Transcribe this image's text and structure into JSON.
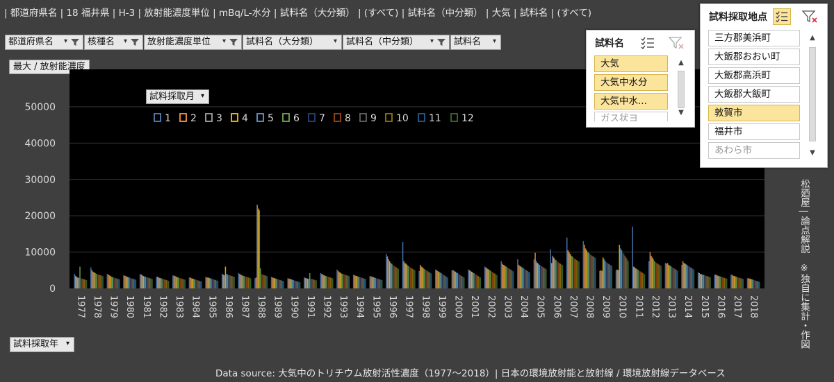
{
  "topbar": {
    "text": "| 都道府県名 | 18 福井県 | H-3 | 放射能濃度単位 | mBq/L-水分 | 試料名（大分類） | (すべて) | 試料名（中分類） | 大気 | 試料名 | (すべて)"
  },
  "fields": {
    "prefecture": "都道府県名",
    "nuclide": "核種名",
    "unit": "放射能濃度単位",
    "sample_major": "試料名（大分類）",
    "sample_mid": "試料名（中分類）",
    "sample": "試料名",
    "values_label": "最大 / 放射能濃度",
    "axis_field": "試料採取年",
    "legend_field": "試料採取月"
  },
  "slicer_sample": {
    "title": "試料名",
    "items": [
      "大気",
      "大気中水分",
      "大気中水...",
      "ガス状ヨ"
    ]
  },
  "slicer_location": {
    "title": "試料採取地点",
    "items": [
      "三方郡美浜町",
      "大飯郡おおい町",
      "大飯郡高浜町",
      "大飯郡大飯町",
      "敦賀市",
      "福井市",
      "あわら市"
    ]
  },
  "side_note": "松廼屋 | 論点解説　※独自に集計・作図",
  "footer": "Data source: 大気中のトリチウム放射活性濃度（1977～2018）| 日本の環境放射能と放射線 / 環境放射線データベース",
  "colors": {
    "m1": "#4f81bd",
    "m2": "#f79646",
    "m3": "#a5a5a5",
    "m4": "#ffc000",
    "m5": "#5b9bd5",
    "m6": "#70ad47",
    "m7": "#264478",
    "m8": "#9e480e",
    "m9": "#636363",
    "m10": "#997300",
    "m11": "#255e91",
    "m12": "#43682b"
  },
  "chart_data": {
    "type": "bar",
    "title": "",
    "xlabel": "試料採取年",
    "ylabel": "最大 / 放射能濃度",
    "ylim": [
      0,
      50000
    ],
    "yticks": [
      0,
      10000,
      20000,
      30000,
      40000,
      50000
    ],
    "grid": true,
    "legend_placement": "top-left",
    "categories": [
      "1977",
      "1978",
      "1979",
      "1980",
      "1981",
      "1982",
      "1983",
      "1984",
      "1985",
      "1986",
      "1987",
      "1988",
      "1989",
      "1990",
      "1991",
      "1992",
      "1993",
      "1994",
      "1995",
      "1996",
      "1997",
      "1998",
      "1999",
      "2000",
      "2001",
      "2002",
      "2003",
      "2004",
      "2005",
      "2006",
      "2007",
      "2008",
      "2009",
      "2010",
      "2011",
      "2012",
      "2013",
      "2014",
      "2015",
      "2016",
      "2017",
      "2018"
    ],
    "series": [
      {
        "name": "1",
        "values": [
          4000,
          5800,
          4000,
          3600,
          4000,
          3200,
          3600,
          3000,
          3200,
          4000,
          4200,
          2800,
          3200,
          2800,
          3000,
          4200,
          5200,
          3800,
          3400,
          9500,
          12800,
          4800,
          5200,
          5000,
          5200,
          6000,
          7500,
          8000,
          8000,
          10800,
          14000,
          13000,
          4800,
          5000,
          17000,
          7500,
          7000,
          6500,
          4500,
          3800,
          3800,
          2800
        ]
      },
      {
        "name": "2",
        "values": [
          3500,
          5000,
          3800,
          3500,
          3800,
          3200,
          3500,
          3000,
          3000,
          3800,
          4000,
          3000,
          3000,
          2700,
          2900,
          4000,
          4800,
          3600,
          3300,
          8800,
          7500,
          6500,
          5000,
          5000,
          5000,
          5800,
          6800,
          6500,
          9800,
          7000,
          10500,
          12000,
          5000,
          5200,
          6000,
          10000,
          6800,
          7500,
          4200,
          3800,
          3700,
          2800
        ]
      },
      {
        "name": "3",
        "values": [
          3200,
          4600,
          3600,
          3400,
          3600,
          3000,
          3400,
          2800,
          3000,
          3600,
          3800,
          23000,
          2900,
          2600,
          2800,
          3800,
          4500,
          3500,
          3200,
          8000,
          7000,
          6000,
          4800,
          4800,
          4800,
          5500,
          6500,
          6200,
          7500,
          9000,
          10000,
          11000,
          4800,
          5000,
          5800,
          9000,
          7000,
          7000,
          4000,
          3600,
          3500,
          2700
        ]
      },
      {
        "name": "4",
        "values": [
          3000,
          4400,
          3400,
          3200,
          3400,
          2900,
          3200,
          2700,
          2900,
          6000,
          3600,
          22000,
          2800,
          2500,
          2700,
          3600,
          4300,
          3400,
          3100,
          7500,
          6800,
          5800,
          4600,
          4600,
          4600,
          5300,
          6300,
          6000,
          7000,
          8500,
          9500,
          10500,
          8500,
          12000,
          5500,
          8500,
          6500,
          6800,
          3900,
          3500,
          3400,
          2600
        ]
      },
      {
        "name": "5",
        "values": [
          2900,
          4200,
          3200,
          3100,
          3300,
          2800,
          3100,
          2600,
          2800,
          4000,
          3500,
          21500,
          2700,
          2400,
          2600,
          3500,
          4100,
          3300,
          3000,
          7000,
          6500,
          5500,
          4400,
          4400,
          4400,
          5100,
          6100,
          5800,
          6800,
          8000,
          9000,
          10000,
          8000,
          11000,
          5300,
          8000,
          6300,
          6600,
          3800,
          3400,
          3300,
          2500
        ]
      },
      {
        "name": "6",
        "values": [
          6000,
          4000,
          3100,
          3000,
          3200,
          2700,
          3000,
          2500,
          2700,
          3800,
          3400,
          5500,
          2600,
          2300,
          4200,
          3400,
          4000,
          3200,
          2900,
          6800,
          6200,
          5300,
          4200,
          4200,
          4200,
          4900,
          5900,
          5600,
          6500,
          7800,
          8800,
          9800,
          7500,
          10500,
          5100,
          7500,
          6100,
          6400,
          3700,
          3300,
          3200,
          2400
        ]
      },
      {
        "name": "7",
        "values": [
          2800,
          3900,
          3000,
          2900,
          3100,
          2600,
          2900,
          2400,
          2600,
          3700,
          3300,
          4000,
          2500,
          2200,
          2700,
          3300,
          3900,
          3100,
          2800,
          6500,
          6000,
          5100,
          4000,
          4000,
          4000,
          4700,
          5700,
          5400,
          6300,
          7500,
          8500,
          9500,
          7200,
          10000,
          4900,
          7200,
          5900,
          6200,
          3600,
          3200,
          3100,
          2300
        ]
      },
      {
        "name": "8",
        "values": [
          2700,
          3800,
          2900,
          2800,
          3000,
          2500,
          2800,
          2300,
          2500,
          3600,
          3200,
          3800,
          2400,
          2100,
          2600,
          3200,
          3800,
          3000,
          2700,
          6200,
          5800,
          4900,
          3800,
          3800,
          3800,
          4500,
          5500,
          5200,
          6100,
          7200,
          8200,
          9200,
          7000,
          9500,
          4700,
          7000,
          5700,
          6000,
          3500,
          3100,
          3000,
          2200
        ]
      },
      {
        "name": "9",
        "values": [
          2600,
          3700,
          2800,
          2700,
          2900,
          2400,
          2700,
          2200,
          2400,
          3500,
          3100,
          3700,
          2300,
          2000,
          2500,
          3100,
          3700,
          2900,
          2600,
          6000,
          5600,
          4700,
          3600,
          3600,
          3600,
          4300,
          5300,
          5000,
          5900,
          7000,
          8000,
          9000,
          6800,
          9000,
          4500,
          6800,
          5500,
          5800,
          3400,
          3000,
          2900,
          2100
        ]
      },
      {
        "name": "10",
        "values": [
          2500,
          3600,
          2700,
          2600,
          2800,
          2300,
          2600,
          2100,
          2300,
          3400,
          3000,
          3600,
          2200,
          1900,
          2400,
          3000,
          3600,
          2800,
          2500,
          5800,
          5400,
          4500,
          3400,
          3400,
          3400,
          4100,
          5100,
          4800,
          5700,
          6800,
          7800,
          8800,
          6600,
          8500,
          4300,
          6600,
          5300,
          5600,
          3300,
          2900,
          2800,
          2000
        ]
      },
      {
        "name": "11",
        "values": [
          2400,
          3500,
          2600,
          2500,
          2700,
          2200,
          2500,
          2000,
          2200,
          3300,
          2900,
          3500,
          2100,
          1800,
          2300,
          2900,
          3500,
          2700,
          2400,
          5600,
          5200,
          4300,
          3200,
          3200,
          3200,
          3900,
          4900,
          4600,
          5500,
          6600,
          7600,
          8600,
          6400,
          8000,
          4100,
          6400,
          5100,
          5400,
          3200,
          2800,
          2700,
          1900
        ]
      },
      {
        "name": "12",
        "values": [
          2300,
          3400,
          2500,
          2400,
          2600,
          2100,
          2400,
          1900,
          2100,
          3200,
          2800,
          3400,
          2000,
          1700,
          2200,
          2800,
          3400,
          2600,
          2300,
          5400,
          5000,
          4100,
          3000,
          3000,
          3000,
          3700,
          4700,
          4400,
          5300,
          6400,
          7400,
          8400,
          6200,
          7500,
          3900,
          6200,
          4900,
          5200,
          3100,
          2700,
          2600,
          1800
        ]
      }
    ]
  }
}
